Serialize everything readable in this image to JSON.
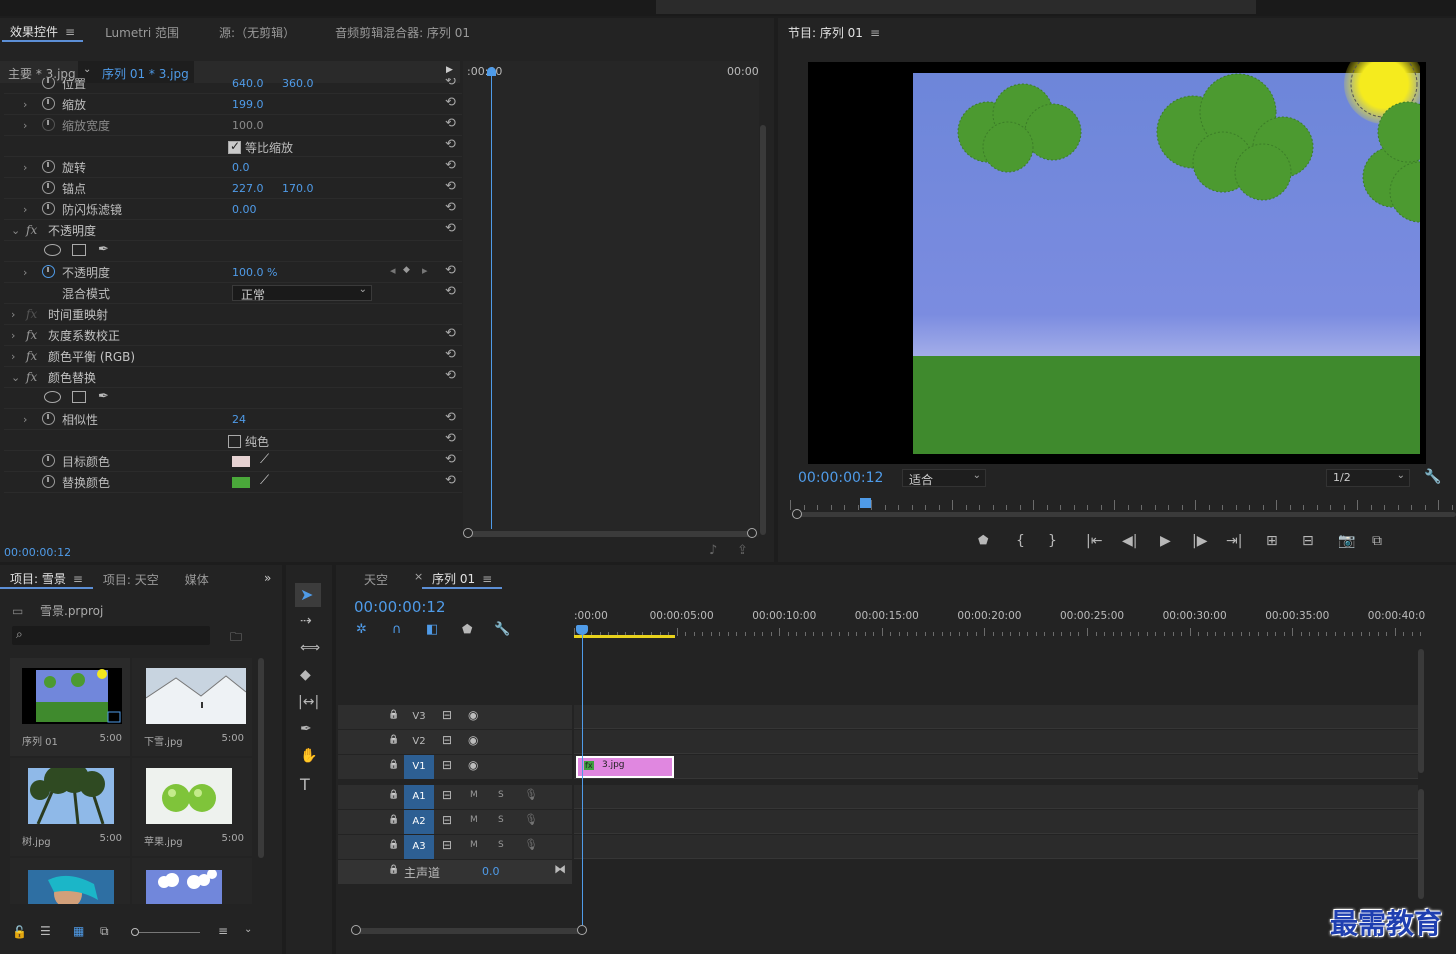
{
  "effects_panel": {
    "tabs": [
      {
        "label": "效果控件",
        "active": true
      },
      {
        "label": "Lumetri 范围"
      },
      {
        "label": "源:（无剪辑）"
      },
      {
        "label": "音频剪辑混合器: 序列 01"
      }
    ],
    "menu_icon": "≡",
    "source_label": "主要 * 3.jpg",
    "sequence_label": "序列 01 * 3.jpg",
    "timeline_start": ":00:00",
    "timeline_end": "00:00",
    "rows": [
      {
        "label": "位置",
        "v1": "640.0",
        "v2": "360.0",
        "type": "param"
      },
      {
        "label": "缩放",
        "v1": "199.0",
        "type": "param",
        "expand": true
      },
      {
        "label": "缩放宽度",
        "v1": "100.0",
        "type": "param-dim",
        "expand": true
      },
      {
        "label": "等比缩放",
        "type": "checkbox",
        "checked": true
      },
      {
        "label": "旋转",
        "v1": "0.0",
        "type": "param",
        "expand": true
      },
      {
        "label": "锚点",
        "v1": "227.0",
        "v2": "170.0",
        "type": "param"
      },
      {
        "label": "防闪烁滤镜",
        "v1": "0.00",
        "type": "param",
        "expand": true
      },
      {
        "label": "不透明度",
        "type": "fx",
        "open": true
      },
      {
        "label": "",
        "type": "masks"
      },
      {
        "label": "不透明度",
        "v1": "100.0 %",
        "type": "param-key",
        "expand": true
      },
      {
        "label": "混合模式",
        "v1": "正常",
        "type": "select"
      },
      {
        "label": "时间重映射",
        "type": "fx-dim"
      },
      {
        "label": "灰度系数校正",
        "type": "fx"
      },
      {
        "label": "颜色平衡 (RGB)",
        "type": "fx"
      },
      {
        "label": "颜色替换",
        "type": "fx",
        "open": true
      },
      {
        "label": "",
        "type": "masks"
      },
      {
        "label": "相似性",
        "v1": "24",
        "type": "param",
        "expand": true
      },
      {
        "label": "纯色",
        "type": "checkbox",
        "checked": false
      },
      {
        "label": "目标颜色",
        "type": "color",
        "color": "#e6d2d2"
      },
      {
        "label": "替换颜色",
        "type": "color",
        "color": "#4aa83a"
      }
    ],
    "timecode": "00:00:00:12"
  },
  "program_monitor": {
    "title": "节目: 序列 01",
    "timecode": "00:00:00:12",
    "fit": "适合",
    "resolution": "1/2",
    "sky_color": "#7187db",
    "grass_color": "#3f8a2d",
    "cloud_color": "#4c9a30",
    "sun_color": "#f3e61e"
  },
  "project_panel": {
    "tabs": [
      {
        "label": "项目: 雪景",
        "active": true
      },
      {
        "label": "项目: 天空"
      },
      {
        "label": "媒体"
      }
    ],
    "more_icon": "»",
    "project_file": "雪景.prproj",
    "items": [
      {
        "name": "序列 01",
        "duration": "5:00",
        "thumb": "sequence"
      },
      {
        "name": "下雪.jpg",
        "duration": "5:00",
        "thumb": "snow"
      },
      {
        "name": "树.jpg",
        "duration": "5:00",
        "thumb": "palm"
      },
      {
        "name": "苹果.jpg",
        "duration": "5:00",
        "thumb": "apple"
      },
      {
        "name": "",
        "duration": "",
        "thumb": "person"
      },
      {
        "name": "",
        "duration": "",
        "thumb": "sky"
      }
    ]
  },
  "timeline_panel": {
    "tabs": [
      {
        "label": "天空"
      },
      {
        "label": "序列 01",
        "active": true
      }
    ],
    "timecode": "00:00:00:12",
    "ruler": [
      ":00:00",
      "00:00:05:00",
      "00:00:10:00",
      "00:00:15:00",
      "00:00:20:00",
      "00:00:25:00",
      "00:00:30:00",
      "00:00:35:00",
      "00:00:40:0"
    ],
    "video_tracks": [
      "V3",
      "V2",
      "V1"
    ],
    "audio_tracks": [
      "A1",
      "A2",
      "A3"
    ],
    "master_label": "主声道",
    "master_value": "0.0",
    "clip": {
      "name": "3.jpg",
      "fx": "fx",
      "color": "#e087e0"
    },
    "mute": "M",
    "solo": "S"
  },
  "watermark": "最需教育"
}
